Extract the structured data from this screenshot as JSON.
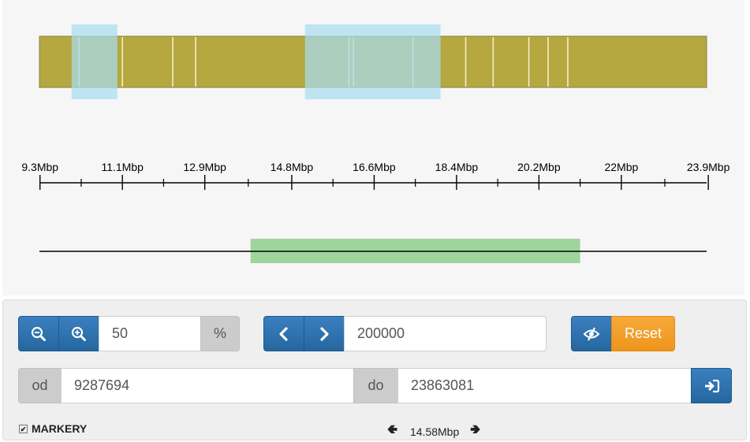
{
  "chart_data": {
    "type": "genome-track",
    "unit": "Mbp",
    "axis_range_bp": [
      9287694,
      23863081
    ],
    "tick_labels": [
      "9.3Mbp",
      "11.1Mbp",
      "12.9Mbp",
      "14.8Mbp",
      "16.6Mbp",
      "18.4Mbp",
      "20.2Mbp",
      "22Mbp",
      "23.9Mbp"
    ],
    "major_ticks_mbp": [
      9.3,
      11.1,
      12.9,
      14.8,
      16.6,
      18.4,
      20.2,
      22.0,
      23.9
    ],
    "minor_ticks_mbp": [
      10.2,
      12.0,
      13.85,
      15.7,
      17.5,
      19.3,
      21.1,
      22.95
    ],
    "track_color": "#b5a840",
    "marker_lines_mbp": [
      10.15,
      11.1,
      12.2,
      12.7,
      16.05,
      16.15,
      17.45,
      18.6,
      19.2,
      19.98,
      20.4,
      20.83
    ],
    "highlight_color": "#a8dcef",
    "highlight_regions_mbp": [
      [
        9.99,
        10.99
      ],
      [
        15.09,
        18.05
      ]
    ],
    "selection_color": "#9fd49c",
    "selection_region_mbp": [
      13.9,
      21.1
    ]
  },
  "controls": {
    "zoom_value": "50",
    "zoom_unit": "%",
    "step_value": "200000",
    "reset_label": "Reset",
    "from_label": "od",
    "from_value": "9287694",
    "to_label": "do",
    "to_value": "23863081",
    "markers_label": "MARKERY",
    "span_label": "14.58Mbp"
  },
  "colors": {
    "primary_button": "#2a6ead",
    "reset_button": "#f29c1f",
    "addon_bg": "#cccccc"
  }
}
